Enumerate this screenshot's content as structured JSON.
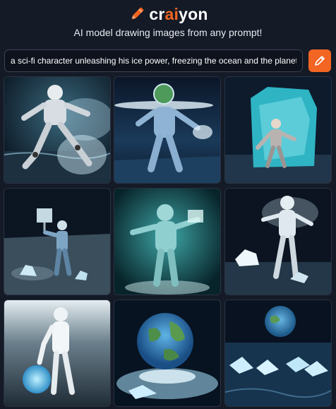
{
  "brand": {
    "name_prefix": "cr",
    "name_highlight": "ai",
    "name_suffix": "yon",
    "accent_color": "#f26522",
    "logo_icon": "crayon-icon"
  },
  "tagline": "AI model drawing images from any prompt!",
  "prompt": {
    "value": "a sci-fi character unleashing his ice power, freezing the ocean and the planet",
    "submit_icon": "pencil-icon"
  },
  "results": {
    "count": 9,
    "images": [
      {
        "subject": "white robot with ice spray over ocean"
      },
      {
        "subject": "figure with ice ring around planet head"
      },
      {
        "subject": "humanoid in front of large ice block"
      },
      {
        "subject": "robot holding ice chunk on icy shore"
      },
      {
        "subject": "glowing figure with arms outstretched"
      },
      {
        "subject": "white figure among ice floes"
      },
      {
        "subject": "figure holding glowing ice orb"
      },
      {
        "subject": "earth globe on frozen ice pad"
      },
      {
        "subject": "planet rising over icebergs at sea"
      }
    ]
  }
}
